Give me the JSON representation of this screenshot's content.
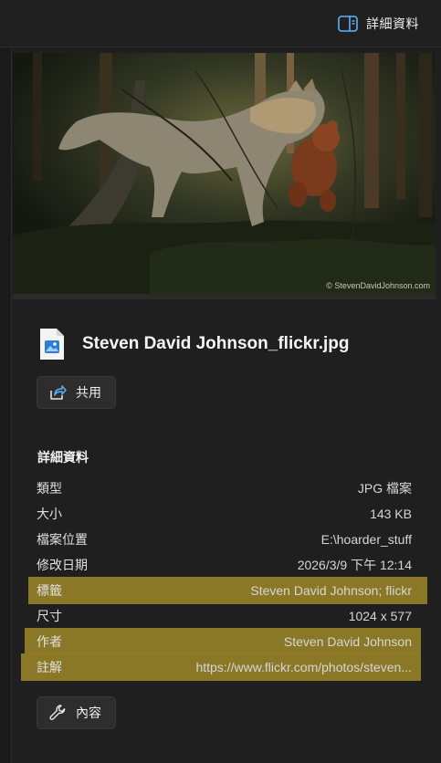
{
  "header": {
    "details_label": "詳細資料",
    "icon": "details-pane-icon"
  },
  "preview": {
    "credit": "© StevenDavidJohnson.com"
  },
  "file": {
    "name": "Steven David Johnson_flickr.jpg",
    "icon": "image-file-icon"
  },
  "actions": {
    "share_label": "共用",
    "properties_label": "內容"
  },
  "details": {
    "title": "詳細資料",
    "rows": [
      {
        "key": "類型",
        "value": "JPG 檔案"
      },
      {
        "key": "大小",
        "value": "143 KB"
      },
      {
        "key": "檔案位置",
        "value": "E:\\hoarder_stuff"
      },
      {
        "key": "修改日期",
        "value": "2026/3/9 下午 12:14"
      },
      {
        "key": "標籤",
        "value": "Steven David Johnson; flickr"
      },
      {
        "key": "尺寸",
        "value": "1024 x 577"
      },
      {
        "key": "作者",
        "value": "Steven David Johnson"
      },
      {
        "key": "註解",
        "value": "https://www.flickr.com/photos/steven..."
      }
    ]
  },
  "colors": {
    "highlight": "#948028",
    "background": "#1f1f1f",
    "accent": "#4fa3f7"
  }
}
